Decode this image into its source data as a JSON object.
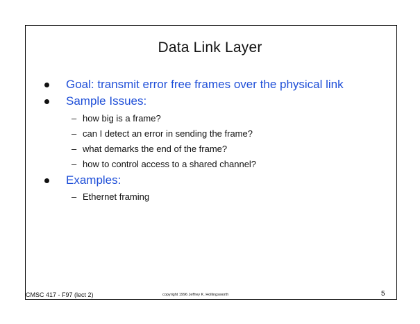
{
  "slide": {
    "title": "Data Link Layer",
    "bullets": [
      {
        "text": "Goal: transmit error free frames over the physical link"
      },
      {
        "text": "Sample Issues:",
        "subitems": [
          "how big is a frame?",
          "can I detect an error in sending the frame?",
          "what demarks the end of the frame?",
          "how to control access to a shared channel?"
        ]
      },
      {
        "text": "Examples:",
        "subitems": [
          "Ethernet framing"
        ]
      }
    ],
    "footer": {
      "course": "CMSC 417 - F97 (lect 2)",
      "copyright": "copyright 1996 Jeffrey K. Hollingsworth",
      "page": "5"
    }
  },
  "colors": {
    "bullet_text": "#1f4fd8",
    "body_text": "#111111"
  }
}
